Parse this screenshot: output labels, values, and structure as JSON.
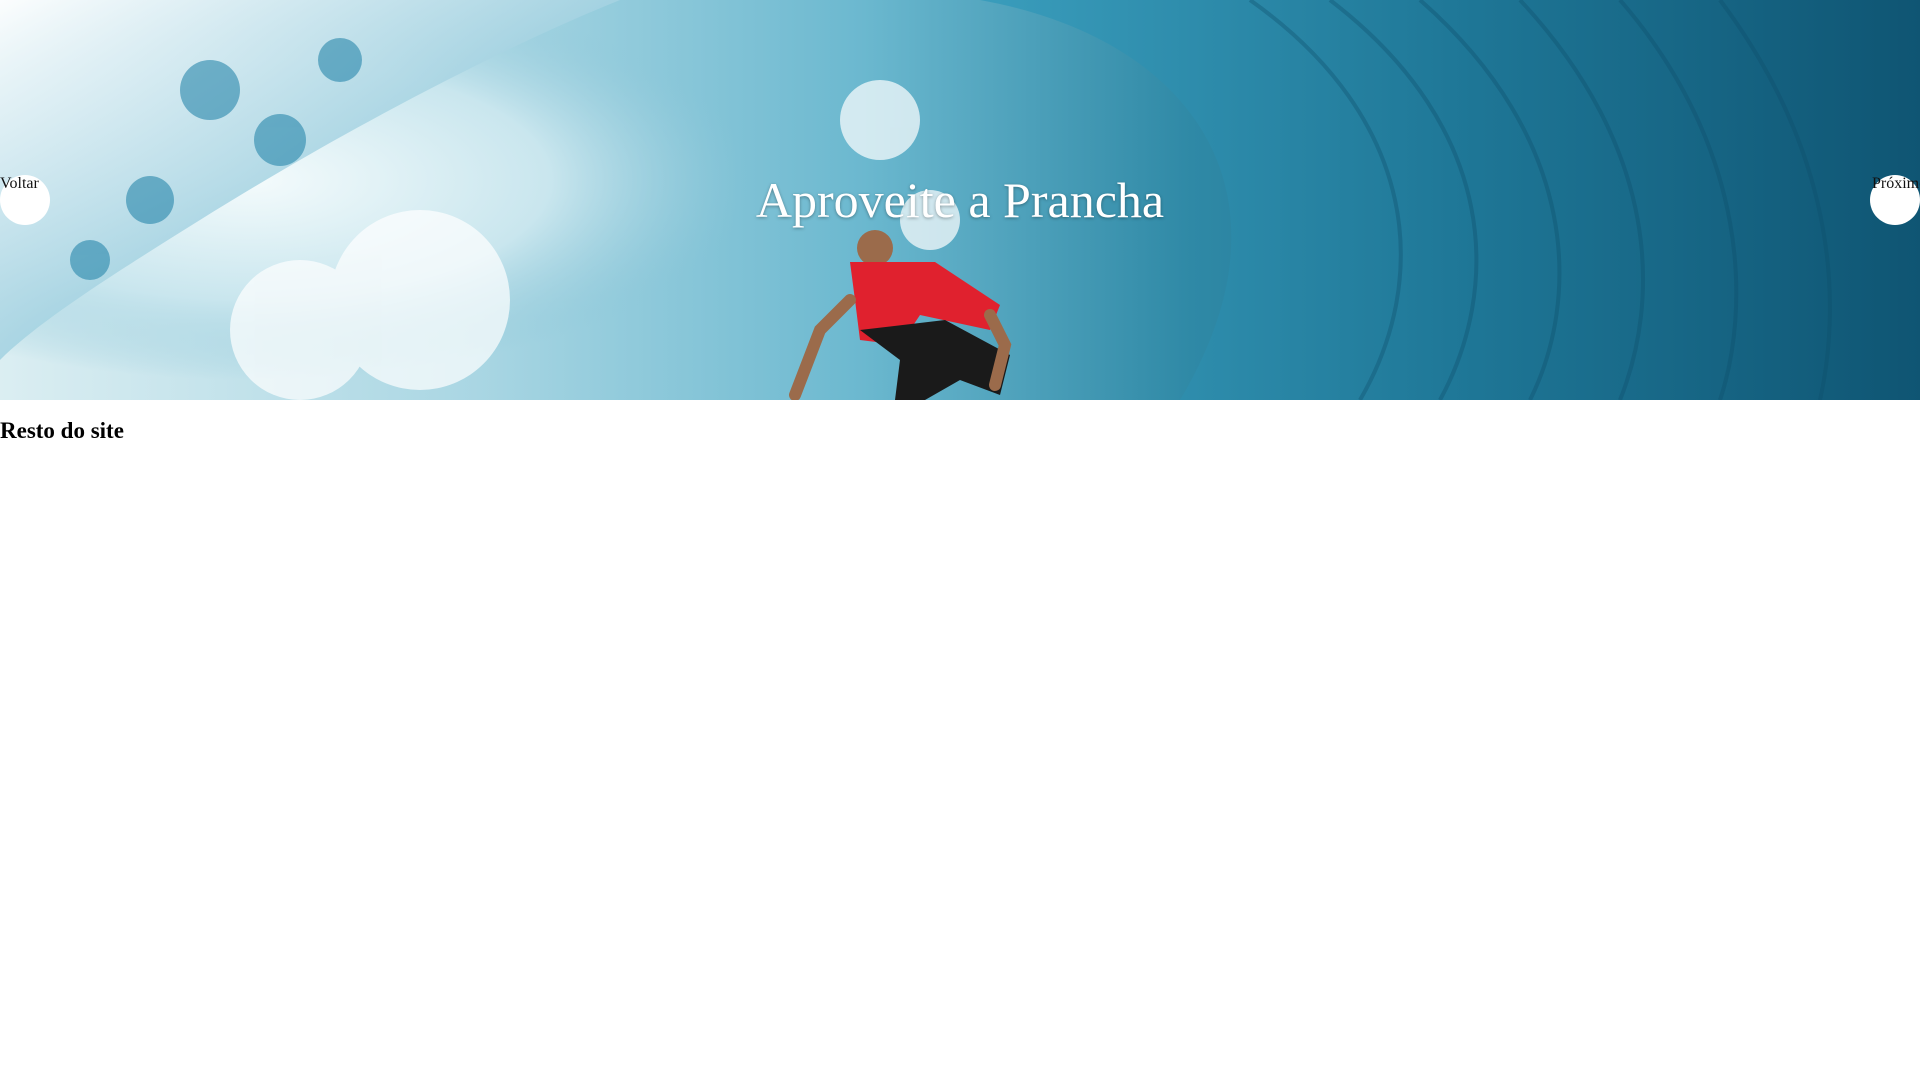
{
  "hero": {
    "title": "Aproveite a Prancha",
    "prev_label": "Voltar",
    "next_label": "Próximo",
    "image_icon": "surfer-in-wave-photo",
    "colors": {
      "wave_light": "#dbeef2",
      "wave_mid": "#2f89a6",
      "wave_dark": "#135f7d",
      "jersey": "#e0212e"
    }
  },
  "main": {
    "heading": "Resto do site"
  }
}
